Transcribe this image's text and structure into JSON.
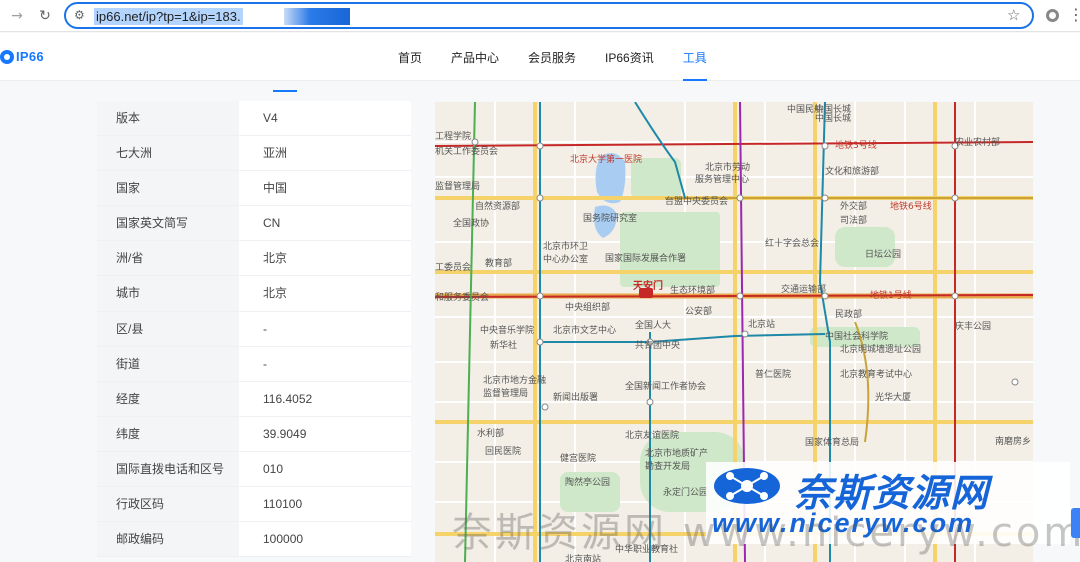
{
  "browser": {
    "url": "ip66.net/ip?tp=1&ip=183.",
    "back_icon": "→",
    "reload_icon": "↻",
    "star_icon": "☆",
    "menu_icon": "⋮"
  },
  "header": {
    "logo_text": "IP66",
    "nav": [
      {
        "label": "首页"
      },
      {
        "label": "产品中心"
      },
      {
        "label": "会员服务"
      },
      {
        "label": "IP66资讯"
      },
      {
        "label": "工具"
      }
    ]
  },
  "info_table": {
    "rows": [
      {
        "label": "版本",
        "value": "V4"
      },
      {
        "label": "七大洲",
        "value": "亚洲"
      },
      {
        "label": "国家",
        "value": "中国"
      },
      {
        "label": "国家英文简写",
        "value": "CN"
      },
      {
        "label": "洲/省",
        "value": "北京"
      },
      {
        "label": "城市",
        "value": "北京"
      },
      {
        "label": "区/县",
        "value": "-"
      },
      {
        "label": "街道",
        "value": "-"
      },
      {
        "label": "经度",
        "value": "116.4052"
      },
      {
        "label": "纬度",
        "value": "39.9049"
      },
      {
        "label": "国际直拨电话和区号",
        "value": "010"
      },
      {
        "label": "行政区码",
        "value": "110100"
      },
      {
        "label": "邮政编码",
        "value": "100000"
      }
    ]
  },
  "map": {
    "labels": [
      {
        "text": "中国民航"
      },
      {
        "text": "中国长城"
      },
      {
        "text": "中国长城"
      },
      {
        "text": "工程学院"
      },
      {
        "text": "机关工作委员会"
      },
      {
        "text": "北京大学第一医院"
      },
      {
        "text": "北京市劳动"
      },
      {
        "text": "服务管理中心"
      },
      {
        "text": "地铁3号线"
      },
      {
        "text": "农业农村部"
      },
      {
        "text": "监督管理局"
      },
      {
        "text": "自然资源部"
      },
      {
        "text": "台盟中央委员会"
      },
      {
        "text": "文化和旅游部"
      },
      {
        "text": "外交部"
      },
      {
        "text": "国务院研究室"
      },
      {
        "text": "地铁6号线"
      },
      {
        "text": "司法部"
      },
      {
        "text": "全国政协"
      },
      {
        "text": "北京市环卫"
      },
      {
        "text": "中心办公室"
      },
      {
        "text": "国家国际发展合作署"
      },
      {
        "text": "红十字会总会"
      },
      {
        "text": "日坛公园"
      },
      {
        "text": "工委员会"
      },
      {
        "text": "教育部"
      },
      {
        "text": "天安门"
      },
      {
        "text": "生态环境部"
      },
      {
        "text": "交通运输部"
      },
      {
        "text": "地铁1号线"
      },
      {
        "text": "和服务委员会"
      },
      {
        "text": "中央组织部"
      },
      {
        "text": "公安部"
      },
      {
        "text": "民政部"
      },
      {
        "text": "中央音乐学院"
      },
      {
        "text": "北京市文艺中心"
      },
      {
        "text": "全国人大"
      },
      {
        "text": "北京站"
      },
      {
        "text": "中国社会科学院"
      },
      {
        "text": "庆丰公园"
      },
      {
        "text": "新华社"
      },
      {
        "text": "共青团中央"
      },
      {
        "text": "北京明城墙遗址公园"
      },
      {
        "text": "北京市地方金融"
      },
      {
        "text": "监督管理局"
      },
      {
        "text": "普仁医院"
      },
      {
        "text": "北京教育考试中心"
      },
      {
        "text": "全国新闻工作者协会"
      },
      {
        "text": "新闻出版署"
      },
      {
        "text": "光华大厦"
      },
      {
        "text": "水利部"
      },
      {
        "text": "北京友谊医院"
      },
      {
        "text": "国家体育总局"
      },
      {
        "text": "南磨房乡"
      },
      {
        "text": "回民医院"
      },
      {
        "text": "健宫医院"
      },
      {
        "text": "北京市地质矿产"
      },
      {
        "text": "勘查开发局"
      },
      {
        "text": "陶然亭公园"
      },
      {
        "text": "永定门公园"
      },
      {
        "text": "北京南站"
      },
      {
        "text": "中华职业教育社"
      }
    ]
  },
  "watermark": {
    "title": "奈斯资源网",
    "url": "www.niceryw.com",
    "overlay": "奈斯资源网 www.niceryw.com"
  },
  "colors": {
    "accent": "#1677ff",
    "url_focus": "#1a73e8",
    "map_bg": "#f3efe6",
    "road_yellow": "#f6d36a",
    "watermark_blue": "#1565d8"
  }
}
